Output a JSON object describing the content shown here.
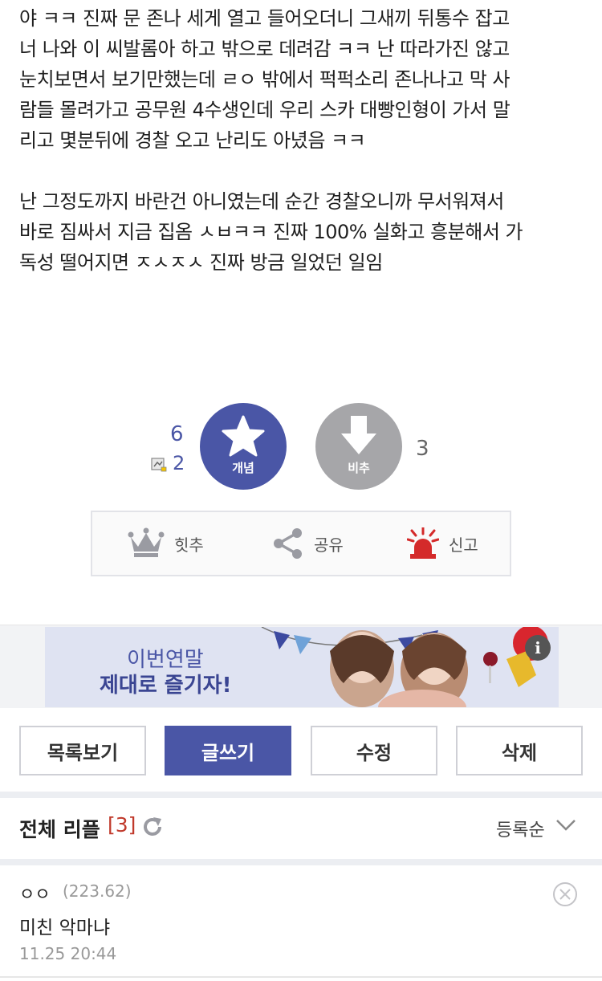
{
  "post": {
    "lines": [
      "야 ㅋㅋ 진짜 문 존나 세게 열고 들어오더니 그새끼 뒤통수 잡고",
      "너 나와 이 씨발롬아 하고 밖으로 데려감 ㅋㅋ 난 따라가진 않고",
      "눈치보면서 보기만했는데 ㄹㅇ 밖에서 퍽퍽소리 존나나고 막 사",
      "람들 몰려가고 공무원 4수생인데 우리 스카 대빵인형이 가서 말",
      "리고 몇분뒤에 경찰 오고 난리도 아녔음 ㅋㅋ"
    ],
    "lines2": [
      "난 그정도까지 바란건 아니였는데 순간 경찰오니까 무서워져서",
      "바로 짐싸서 지금 집옴 ㅅㅂㅋㅋ 진짜 100% 실화고 흥분해서 가",
      "독성 떨어지면 ㅈㅅㅈㅅ 진짜 방금 일었던 일임"
    ]
  },
  "votes": {
    "up_count": "6",
    "fixed_count": "2",
    "up_label": "개념",
    "down_label": "비추",
    "down_count": "3",
    "accent": "#4a56a6",
    "down_color": "#a6a6a9"
  },
  "actions": {
    "hit": "힛추",
    "share": "공유",
    "report": "신고"
  },
  "ad": {
    "line1": "이번연말",
    "line2": "제대로 즐기자!",
    "info": "i"
  },
  "buttons": {
    "list": "목록보기",
    "write": "글쓰기",
    "edit": "수정",
    "delete": "삭제"
  },
  "comments": {
    "title": "전체 리플",
    "count": "[3]",
    "sort": "등록순",
    "items": [
      {
        "author": "ㅇㅇ",
        "ip": "(223.62)",
        "text": "미친 악마냐",
        "time": "11.25 20:44"
      }
    ]
  }
}
